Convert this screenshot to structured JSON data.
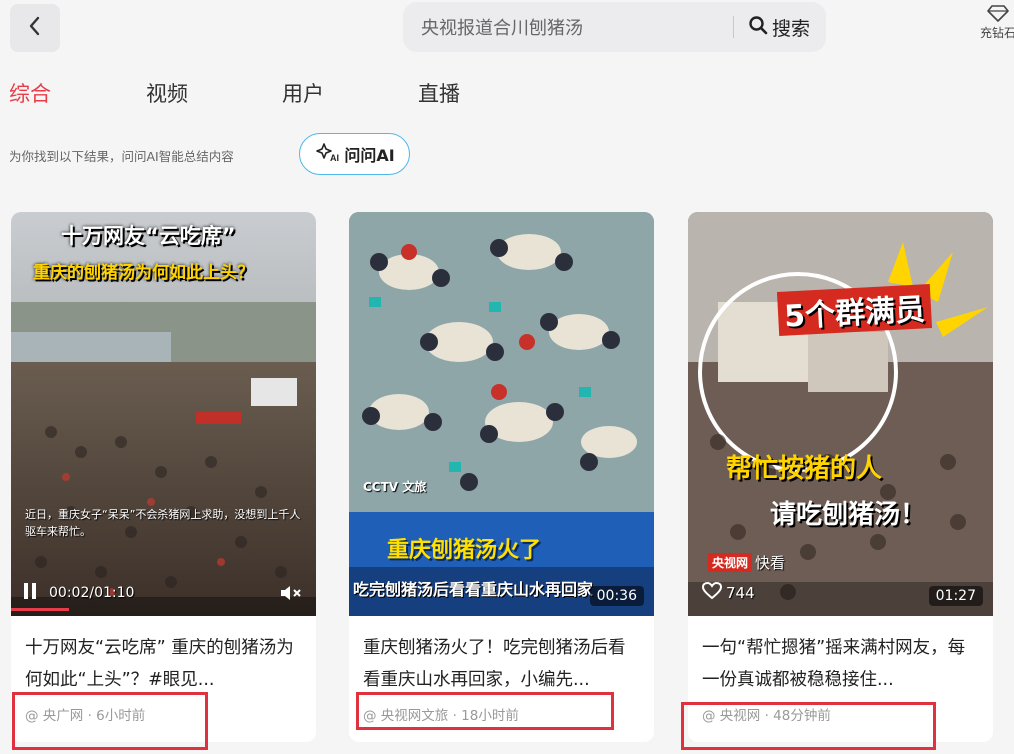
{
  "header": {
    "search_text": "央视报道合川刨猪汤",
    "search_label": "搜索",
    "recharge_label": "充钻石"
  },
  "tabs": [
    {
      "label": "综合",
      "active": true
    },
    {
      "label": "视频",
      "active": false
    },
    {
      "label": "用户",
      "active": false
    },
    {
      "label": "直播",
      "active": false
    }
  ],
  "ai": {
    "hint": "为你找到以下结果，问问AI智能总结内容",
    "button_label": "问问AI"
  },
  "colors": {
    "accent": "#e83d48",
    "ai_border": "#4fb8e8",
    "highlight_box": "#e0323e"
  },
  "cards": [
    {
      "overlay_title_1": "十万网友“云吃席”",
      "overlay_title_2": "重庆的刨猪汤为何如此上头？",
      "caption": "近日，重庆女子“呆呆”不会杀猪网上求助，没想到上千人驱车来帮忙。",
      "time": "00:02/01:10",
      "title": "十万网友“云吃席” 重庆的刨猪汤为何如此“上头”？#眼见...",
      "meta": "@ 央广网 · 6小时前"
    },
    {
      "overlay_logo": "CCTV 文旅",
      "overlay_banner_1": "重庆刨猪汤火了",
      "overlay_banner_2": "吃完刨猪汤后看看重庆山水再回家",
      "duration": "00:36",
      "title": "重庆刨猪汤火了！吃完刨猪汤后看看重庆山水再回家，小编先...",
      "meta": "@ 央视网文旅 · 18小时前"
    },
    {
      "overlay_title_1": "5个群满员",
      "overlay_title_2": "帮忙按猪的人",
      "overlay_title_3": "请吃刨猪汤！",
      "source_badge": "央视网",
      "source_suffix": "快看",
      "likes": "744",
      "duration": "01:27",
      "title": "一句“帮忙摁猪”摇来满村网友，每一份真诚都被稳稳接住...",
      "meta": "@ 央视网 · 48分钟前"
    }
  ]
}
